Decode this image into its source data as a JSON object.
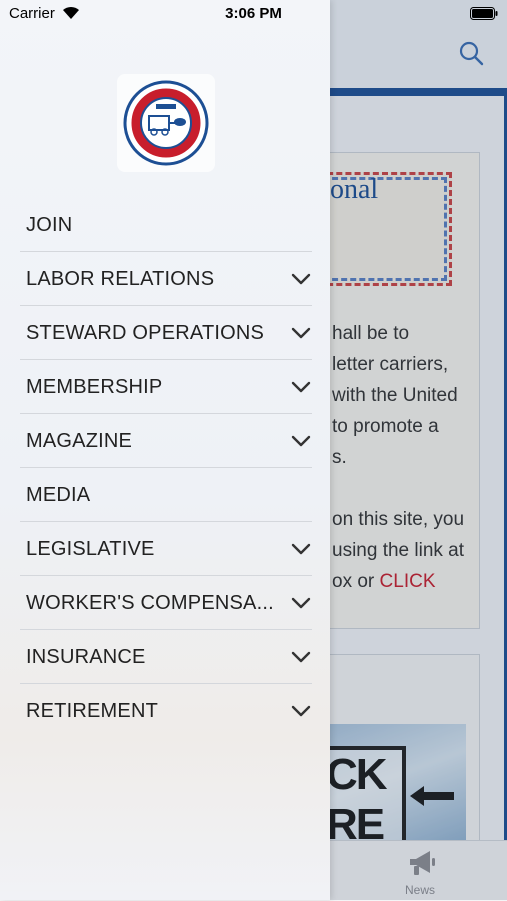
{
  "status_bar": {
    "carrier": "Carrier",
    "time": "3:06 PM"
  },
  "drawer": {
    "logo_icon": "nrlca-logo-icon",
    "logo_text": "SERVICE WITH A SMILE · NATIONAL RURAL LETTER CARRIERS' ASSOCIATION · 1903",
    "items": [
      {
        "label": "JOIN",
        "has_submenu": false
      },
      {
        "label": "LABOR RELATIONS",
        "has_submenu": true
      },
      {
        "label": "STEWARD OPERATIONS",
        "has_submenu": true
      },
      {
        "label": "MEMBERSHIP",
        "has_submenu": true
      },
      {
        "label": "MAGAZINE",
        "has_submenu": true
      },
      {
        "label": "MEDIA",
        "has_submenu": false
      },
      {
        "label": "LEGISLATIVE",
        "has_submenu": true
      },
      {
        "label": "WORKER'S COMPENSA...",
        "has_submenu": true
      },
      {
        "label": "INSURANCE",
        "has_submenu": true
      },
      {
        "label": "RETIREMENT",
        "has_submenu": true
      }
    ]
  },
  "background": {
    "stamp_text": "onal",
    "paragraph_lines": [
      "hall be to",
      " letter carriers,",
      " with the United",
      "to promote a",
      "s.",
      "",
      "on this site, you",
      "using the link at",
      "ox or "
    ],
    "paragraph_accent": "CLICK",
    "click_text_1": "CK",
    "click_text_2": "RE",
    "tab_news_label": "News"
  },
  "colors": {
    "brand_blue": "#1d4f94",
    "accent_red": "#c81e2c"
  }
}
